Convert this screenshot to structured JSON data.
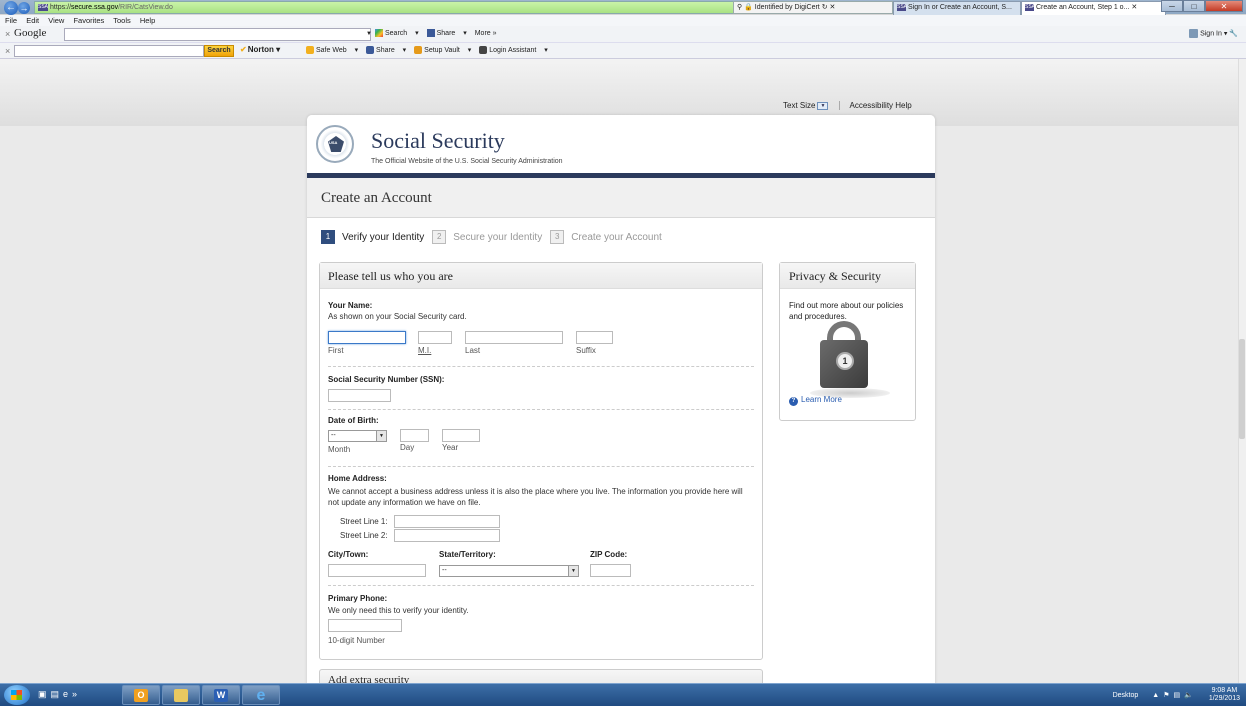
{
  "browser": {
    "url_scheme": "https://",
    "url_host": "secure.ssa.gov",
    "url_path": "/RIR/CatsView.do",
    "cert_text": "Identified by DigiCert",
    "tabs": [
      {
        "label": "Sign In or Create an Account, S..."
      },
      {
        "label": "Create an Account, Step 1 o..."
      }
    ],
    "menu": [
      "File",
      "Edit",
      "View",
      "Favorites",
      "Tools",
      "Help"
    ],
    "favicon_text": "SSA"
  },
  "google_toolbar": {
    "logo": "Google",
    "search_label": "Search",
    "share_label": "Share",
    "more_label": "More »",
    "signin_label": "Sign In"
  },
  "norton_toolbar": {
    "search_button": "Search",
    "brand": "Norton",
    "items": [
      "Safe Web",
      "Share",
      "Setup Vault",
      "Login Assistant"
    ]
  },
  "page": {
    "text_size_label": "Text Size",
    "accessibility_label": "Accessibility Help",
    "site_title": "Social Security",
    "site_subtitle": "The Official Website of the U.S. Social Security Administration",
    "seal_text": "USA",
    "page_title": "Create an Account",
    "steps": [
      {
        "num": "1",
        "label": "Verify your Identity",
        "active": true
      },
      {
        "num": "2",
        "label": "Secure your Identity",
        "active": false
      },
      {
        "num": "3",
        "label": "Create your Account",
        "active": false
      }
    ]
  },
  "form": {
    "heading": "Please tell us who you are",
    "name_label": "Your Name:",
    "name_note": "As shown on your Social Security card.",
    "first_label": "First",
    "mi_label": "M.I.",
    "last_label": "Last",
    "suffix_label": "Suffix",
    "ssn_label": "Social Security Number (SSN):",
    "dob_label": "Date of Birth:",
    "month_value": "--",
    "month_label": "Month",
    "day_label": "Day",
    "year_label": "Year",
    "address_label": "Home Address:",
    "address_note": "We cannot accept a business address unless it is also the place where you live. The information you provide here will not update any information we have on file.",
    "street1_label": "Street Line 1:",
    "street2_label": "Street Line 2:",
    "city_label": "City/Town:",
    "state_label": "State/Territory:",
    "state_value": "--",
    "zip_label": "ZIP Code:",
    "phone_label": "Primary Phone:",
    "phone_note": "We only need this to verify your identity.",
    "phone_sub": "10-digit Number",
    "next_section": "Add extra security"
  },
  "privacy": {
    "heading": "Privacy & Security",
    "text": "Find out more about our policies and procedures.",
    "learn_more": "Learn More"
  },
  "taskbar": {
    "desktop_label": "Desktop",
    "time": "9:08 AM",
    "date": "1/29/2013"
  }
}
